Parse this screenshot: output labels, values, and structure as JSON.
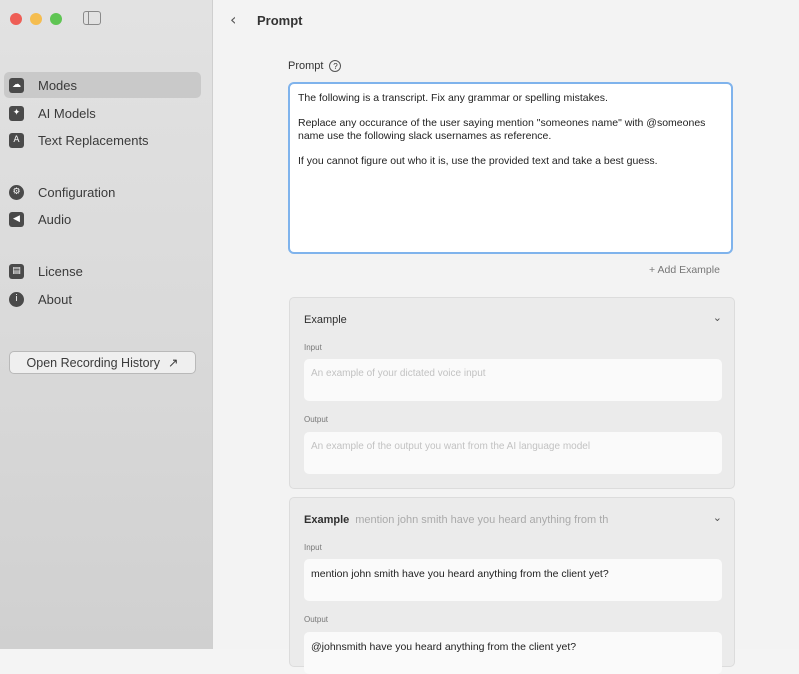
{
  "window": {
    "title": "Prompt"
  },
  "sidebar": {
    "groups": [
      [
        {
          "label": "Modes",
          "icon": "brain-icon",
          "glyph": "☁",
          "active": true
        },
        {
          "label": "AI Models",
          "icon": "ai-chip-icon",
          "glyph": "✦"
        },
        {
          "label": "Text Replacements",
          "icon": "text-replace-icon",
          "glyph": "A"
        }
      ],
      [
        {
          "label": "Configuration",
          "icon": "gear-icon",
          "glyph": "⚙"
        },
        {
          "label": "Audio",
          "icon": "speaker-icon",
          "glyph": "◀"
        }
      ],
      [
        {
          "label": "License",
          "icon": "license-icon",
          "glyph": "▤"
        },
        {
          "label": "About",
          "icon": "info-icon",
          "glyph": "i"
        }
      ]
    ],
    "history_button": "Open Recording History",
    "history_arrow": "↗"
  },
  "prompt": {
    "label": "Prompt",
    "help_glyph": "?",
    "paragraphs": [
      "The following is a transcript. Fix any grammar or spelling mistakes.",
      "Replace any occurance of the user saying mention \"someones name\" with @someones name use the following slack usernames as reference.",
      "If you cannot figure out who it is, use the provided text and take a best guess."
    ]
  },
  "add_example": "+ Add Example",
  "examples": [
    {
      "title": "Example",
      "subtitle": "",
      "input_label": "Input",
      "input_placeholder": "An example of your dictated voice input",
      "input_value": "",
      "output_label": "Output",
      "output_placeholder": "An example of the output you want from the AI language model",
      "output_value": ""
    },
    {
      "title": "Example",
      "subtitle": "mention john smith have you heard anything from th",
      "input_label": "Input",
      "input_value": "mention john smith have you heard anything from the client yet?",
      "output_label": "Output",
      "output_value": "@johnsmith have you heard anything from the client yet?"
    }
  ],
  "colors": {
    "focus_border": "#7fb3ec",
    "sidebar_bg": "#dcdcdc",
    "close": "#ee5e56",
    "minimize": "#f5bd4f",
    "zoom": "#5fc553"
  }
}
